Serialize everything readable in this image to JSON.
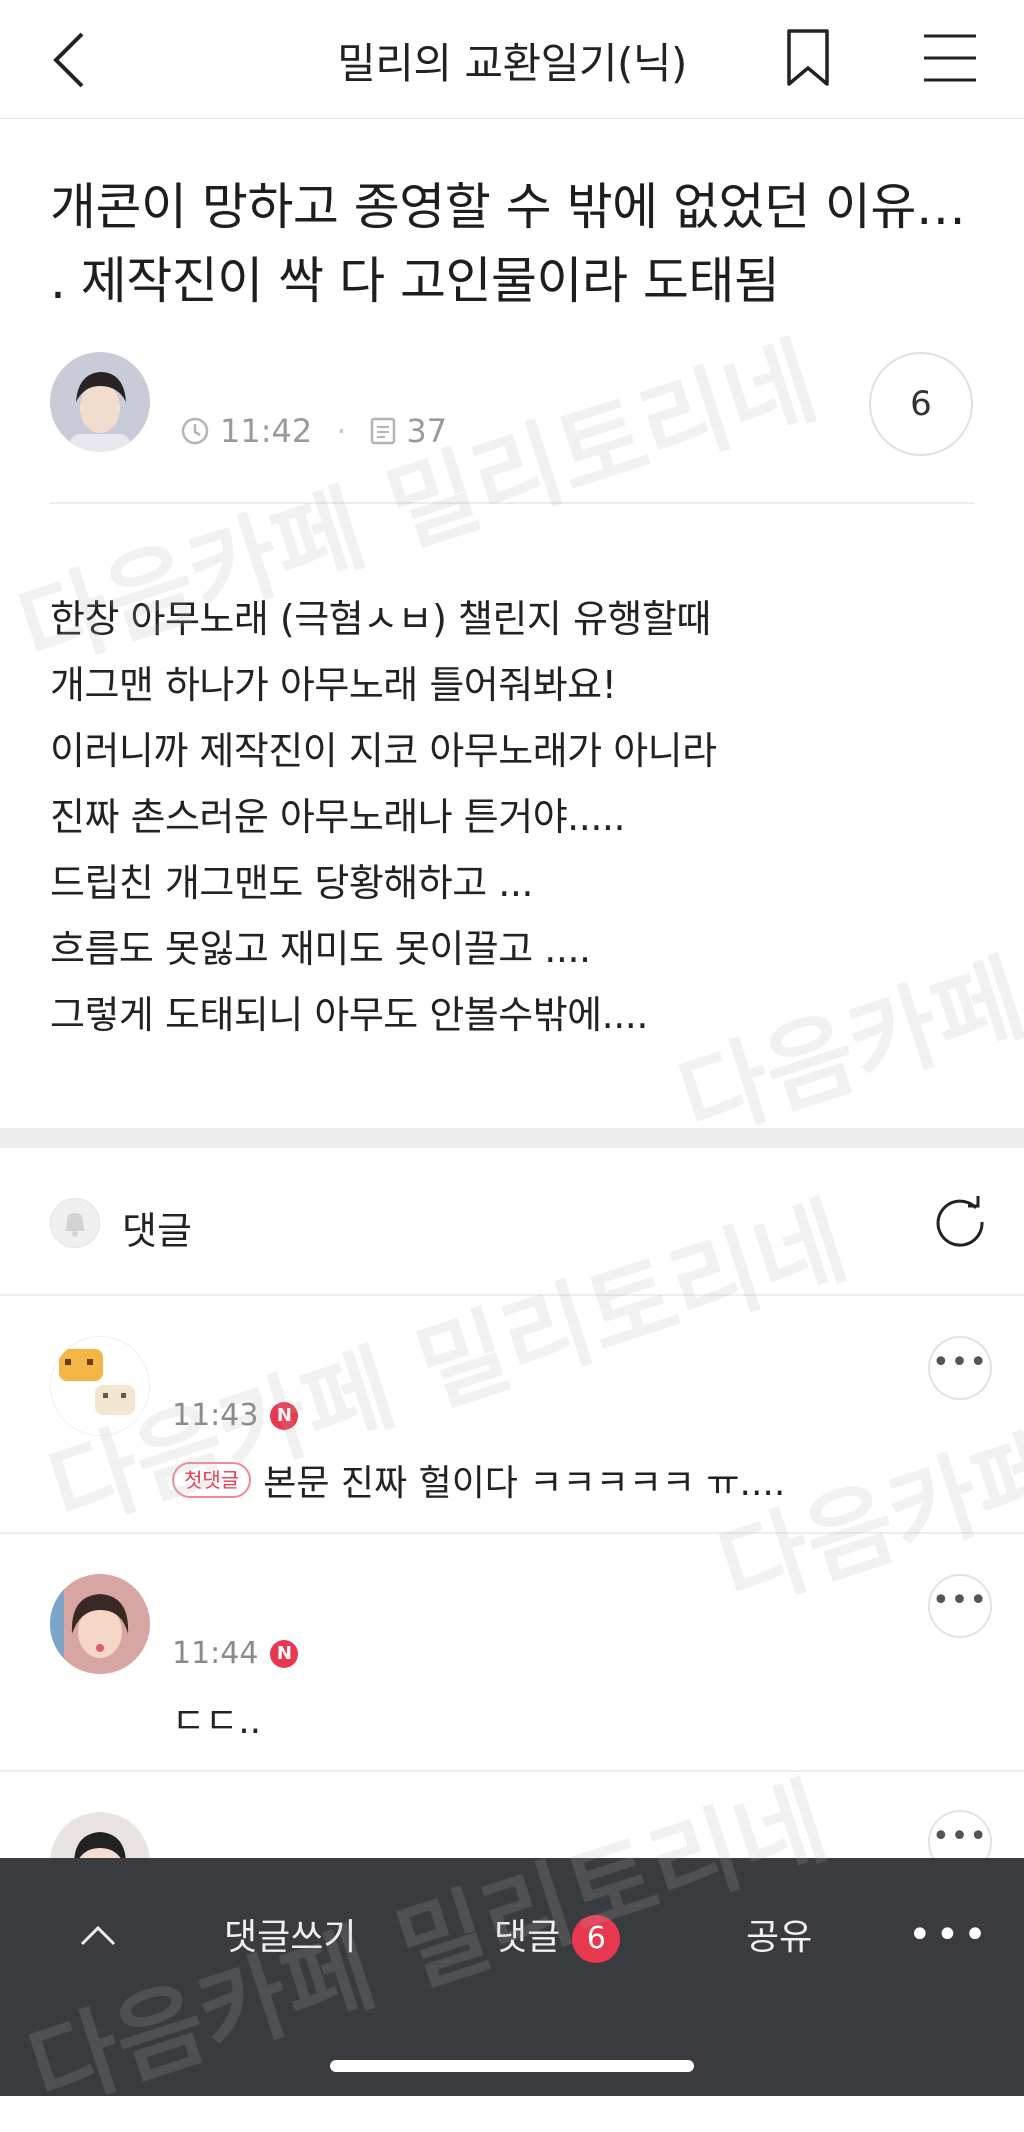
{
  "header": {
    "title": "밀리의 교환일기(닉)"
  },
  "post": {
    "title_line1": "개콘이 망하고 종영할 수 밖에 없었던 이유…",
    "title_line2": ". 제작진이 싹 다 고인물이라 도태됨",
    "time": "11:42",
    "views": "37",
    "comment_count": "6",
    "body": [
      "한창 아무노래 (극혐ㅅㅂ) 챌린지 유행할때",
      "개그맨 하나가 아무노래 틀어줘봐요!",
      "이러니까 제작진이 지코 아무노래가 아니라",
      "진짜 촌스러운 아무노래나 튼거야.....",
      "드립친 개그맨도 당황해하고 ...",
      "흐름도 못잃고 재미도 못이끌고 ....",
      "그렇게 도태되니 아무도 안볼수밖에...."
    ]
  },
  "comments_section": {
    "label": "댓글",
    "items": [
      {
        "time": "11:43",
        "new_badge": "N",
        "first_badge": "첫댓글",
        "text": "본문 진짜 헐이다 ㅋㅋㅋㅋㅋ ㅠ...."
      },
      {
        "time": "11:44",
        "new_badge": "N",
        "text": "ㄷㄷ.."
      }
    ],
    "more_label": "•••"
  },
  "bottom_bar": {
    "write_comment": "댓글쓰기",
    "comments": "댓글",
    "comments_count": "6",
    "share": "공유",
    "more": "•••"
  },
  "watermark": {
    "text1": "다음카페 밀리토리네",
    "text2": "다음카페"
  },
  "colors": {
    "accent": "#e8384f",
    "bottom_bar": "#3a3b3f",
    "divider": "#ededed"
  },
  "icons": [
    "back-arrow-icon",
    "bookmark-icon",
    "hamburger-menu-icon",
    "clock-icon",
    "document-icon",
    "bell-icon",
    "refresh-icon",
    "more-dots-icon",
    "chevron-up-icon"
  ]
}
